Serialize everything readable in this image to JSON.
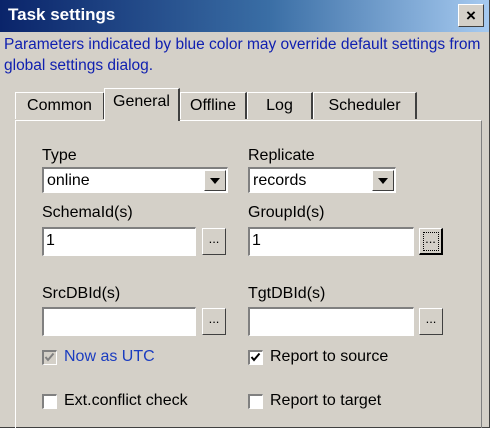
{
  "window": {
    "title": "Task settings",
    "close_glyph": "×",
    "notice": "Parameters indicated by blue color may override default settings from global settings dialog."
  },
  "tabs": [
    {
      "label": "Common",
      "active": false
    },
    {
      "label": "General",
      "active": true
    },
    {
      "label": "Offline",
      "active": false
    },
    {
      "label": "Log",
      "active": false
    },
    {
      "label": "Scheduler",
      "active": false
    }
  ],
  "general": {
    "type": {
      "label": "Type",
      "value": "online"
    },
    "replicate": {
      "label": "Replicate",
      "value": "records"
    },
    "schema_ids": {
      "label": "SchemaId(s)",
      "value": "1",
      "browse_label": "..."
    },
    "group_ids": {
      "label": "GroupId(s)",
      "value": "1",
      "browse_label": "..."
    },
    "src_db_ids": {
      "label": "SrcDBId(s)",
      "value": "",
      "browse_label": "..."
    },
    "tgt_db_ids": {
      "label": "TgtDBId(s)",
      "value": "",
      "browse_label": "..."
    },
    "now_as_utc": {
      "label": "Now as UTC",
      "checked": true,
      "enabled": false
    },
    "report_to_source": {
      "label": "Report to source",
      "checked": true
    },
    "ext_conflict_check": {
      "label": "Ext.conflict check",
      "checked": false
    },
    "report_to_target": {
      "label": "Report to target",
      "checked": false
    }
  },
  "colors": {
    "title_gradient_start": "#0a246a",
    "title_gradient_end": "#a6caf0",
    "notice_text": "#1020b0",
    "override_label": "#1a3cc0",
    "face": "#d4d0c8"
  },
  "icons": {
    "close": "close-icon",
    "dropdown": "chevron-down-icon",
    "check": "checkmark-icon"
  }
}
